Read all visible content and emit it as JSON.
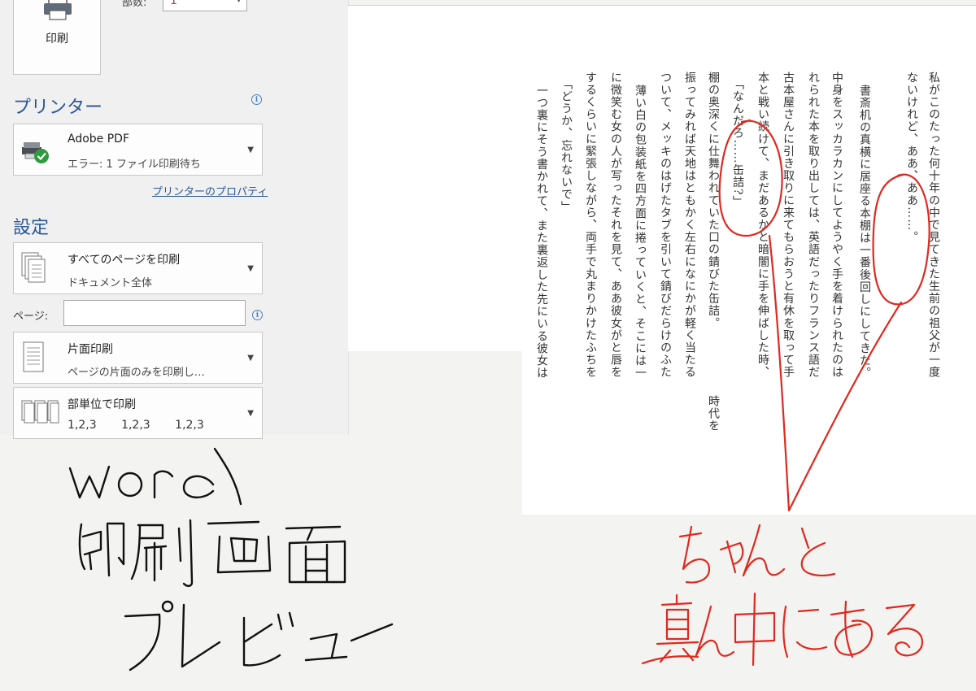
{
  "print_panel": {
    "print_button_label": "印刷",
    "copies_label": "部数:",
    "copies_value": "1",
    "printer_section_title": "プリンター",
    "printer": {
      "name": "Adobe PDF",
      "status": "エラー: 1 ファイル印刷待ち"
    },
    "printer_properties_link": "プリンターのプロパティ",
    "settings_section_title": "設定",
    "pages_scope": {
      "title": "すべてのページを印刷",
      "subtitle": "ドキュメント全体"
    },
    "pages_label": "ページ:",
    "pages_value": "",
    "sides": {
      "title": "片面印刷",
      "subtitle": "ページの片面のみを印刷し…"
    },
    "collate": {
      "title": "部単位で印刷",
      "values": [
        "1,2,3",
        "1,2,3",
        "1,2,3"
      ]
    },
    "accent_color": "#2b5797",
    "status_ok_color": "#2e9b3e"
  },
  "document_preview": {
    "columns": [
      "私がこのたった何十年の中で見てきた生前の祖父が一度",
      "ないけれど、ああ、ああ……。",
      "",
      "書斎机の真横に居座る本棚は一番後回しにしてきた。",
      "中身をスッカラカンにしてようやく手を着けられたのは",
      "れられた本を取り出しては、英語だったりフランス語だ",
      "古本屋さんに引き取りに来てもらおうと有休を取って手",
      "本と戦い続けて、まだあるかと暗闇に手を伸ばした時、",
      "「なんだろ……缶詰?」",
      "棚の奥深くに仕舞われていた口の錆びた缶詰。",
      "振ってみれば天地はともかく左右になにかが軽く当たる",
      "ついて、メッキのはげたタブを引いて錆びだらけのふた",
      "薄い白の包装紙を四方面に捲っていくと、そこには一",
      "に微笑む女の人が写ったそれを見て、ああ彼女がと唇を",
      "するくらいに緊張しながら、両手で丸まりかけたふちを",
      "「どうか、忘れないで」",
      "一つ裏にそう書かれて、また裏返した先にいる彼女は"
    ],
    "extra_column_text": "時代を"
  },
  "annotations": {
    "handwritten_note_black": [
      "word",
      "印刷画面",
      "プレビュー"
    ],
    "handwritten_note_red": [
      "ちゃんと",
      "真ん中にある"
    ],
    "ink_black": "#111111",
    "ink_red": "#e0281e"
  }
}
